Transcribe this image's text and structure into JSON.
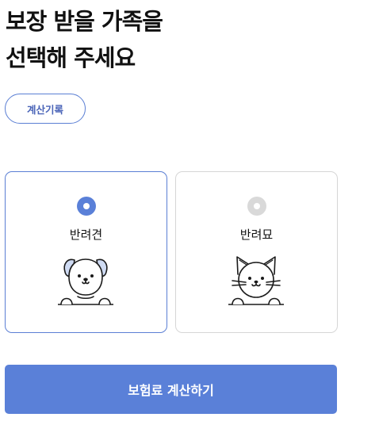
{
  "header": {
    "title_line1": "보장 받을 가족을",
    "title_line2": "선택해 주세요"
  },
  "history_button": {
    "label": "계산기록"
  },
  "options": [
    {
      "label": "반려견",
      "selected": true,
      "icon": "dog-icon"
    },
    {
      "label": "반려묘",
      "selected": false,
      "icon": "cat-icon"
    }
  ],
  "cta": {
    "label": "보험료 계산하기"
  },
  "colors": {
    "accent": "#5a80d8",
    "accent_border": "#5b7fd4",
    "unselected_radio": "#d9d9d9",
    "card_border": "#d6d6d6",
    "dog_ear": "#cfdbf3"
  }
}
